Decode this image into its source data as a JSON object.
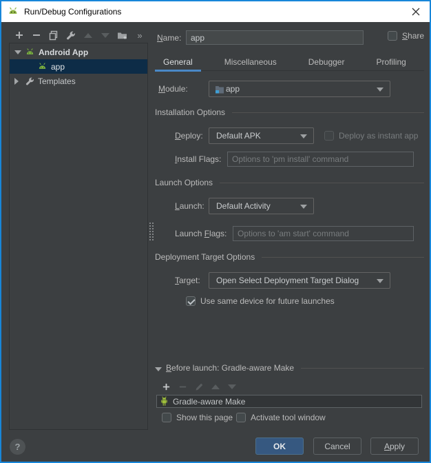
{
  "window": {
    "title": "Run/Debug Configurations",
    "close_glyph": "✕"
  },
  "tree": {
    "toolbar_overflow_glyph": "»",
    "items": [
      {
        "label": "Android App"
      },
      {
        "label": "app"
      },
      {
        "label": "Templates"
      }
    ]
  },
  "form": {
    "name": {
      "label": {
        "text": "Name:",
        "m": 0
      },
      "value": "app"
    },
    "share": {
      "label": {
        "text": "Share",
        "m": 0
      }
    },
    "tabs": [
      {
        "label": "General"
      },
      {
        "label": "Miscellaneous"
      },
      {
        "label": "Debugger"
      },
      {
        "label": "Profiling"
      }
    ],
    "module": {
      "label": {
        "text": "Module:",
        "m": 0
      },
      "value": "app"
    },
    "sections": {
      "installation": "Installation Options",
      "launch": "Launch Options",
      "deployment": "Deployment Target Options"
    },
    "deploy": {
      "label": {
        "text": "Deploy:",
        "m": 0
      },
      "value": "Default APK"
    },
    "instant_app": {
      "label": "Deploy as instant app"
    },
    "install_flags": {
      "label": {
        "text": "Install Flags:",
        "m": 0
      },
      "placeholder": "Options to 'pm install' command"
    },
    "launch": {
      "label": {
        "text": "Launch:",
        "m": 0
      },
      "value": "Default Activity"
    },
    "launch_flags": {
      "label": {
        "text": "Launch Flags:",
        "m": 7
      },
      "placeholder": "Options to 'am start' command"
    },
    "target": {
      "label": {
        "text": "Target:",
        "m": 0
      },
      "value": "Open Select Deployment Target Dialog"
    },
    "same_device": {
      "label": "Use same device for future launches"
    },
    "before_launch": {
      "header": {
        "text": "Before launch: Gradle-aware Make",
        "m": 0
      },
      "task": "Gradle-aware Make"
    },
    "show_page": {
      "label": "Show this page"
    },
    "activate_tool": {
      "label": "Activate tool window"
    }
  },
  "footer": {
    "help_glyph": "?",
    "ok": "OK",
    "cancel": "Cancel",
    "apply": {
      "text": "Apply",
      "m": 0
    }
  },
  "colors": {
    "window_border": "#1886d9",
    "tab_accent": "#4a88c7",
    "tree_selection": "#0d2c47",
    "ok_button": "#365880",
    "android_green": "#93b849",
    "module_blue": "#3f9fd5"
  }
}
